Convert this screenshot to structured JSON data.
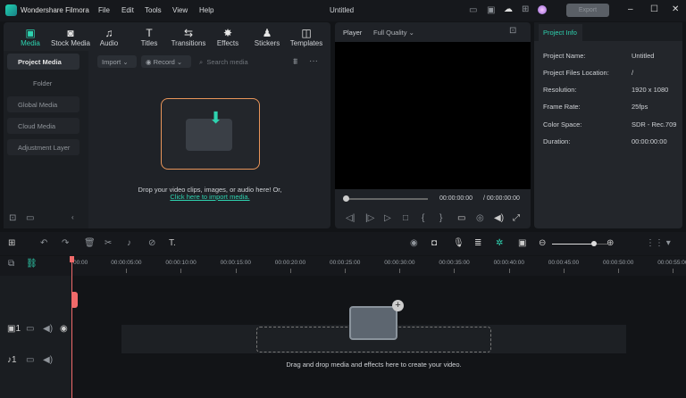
{
  "app": {
    "name": "Wondershare Filmora",
    "title": "Untitled",
    "export_label": "Export"
  },
  "menu": [
    "File",
    "Edit",
    "Tools",
    "View",
    "Help"
  ],
  "tabs": [
    {
      "label": "Media",
      "icon": "media-icon"
    },
    {
      "label": "Stock Media",
      "icon": "stock-icon"
    },
    {
      "label": "Audio",
      "icon": "music-icon"
    },
    {
      "label": "Titles",
      "icon": "text-icon"
    },
    {
      "label": "Transitions",
      "icon": "transition-icon"
    },
    {
      "label": "Effects",
      "icon": "sparkle-icon"
    },
    {
      "label": "Stickers",
      "icon": "sticker-icon"
    },
    {
      "label": "Templates",
      "icon": "template-icon"
    }
  ],
  "sidebar": {
    "items": [
      "Project Media",
      "Folder",
      "Global Media",
      "Cloud Media",
      "Adjustment Layer"
    ]
  },
  "media": {
    "import": "Import",
    "record": "Record",
    "search_placeholder": "Search media",
    "drop_text": "Drop your video clips, images, or audio here! Or,",
    "import_link": "Click here to import media."
  },
  "player": {
    "label": "Player",
    "quality": "Full Quality",
    "current_time": "00:00:00:00",
    "total_time": "/ 00:00:00:00"
  },
  "info": {
    "tab": "Project Info",
    "rows": [
      {
        "k": "Project Name:",
        "v": "Untitled"
      },
      {
        "k": "Project Files Location:",
        "v": "/"
      },
      {
        "k": "Resolution:",
        "v": "1920 x 1080"
      },
      {
        "k": "Frame Rate:",
        "v": "25fps"
      },
      {
        "k": "Color Space:",
        "v": "SDR - Rec.709"
      },
      {
        "k": "Duration:",
        "v": "00:00:00:00"
      }
    ]
  },
  "timeline": {
    "ticks": [
      "00:00",
      "00:00:05:00",
      "00:00:10:00",
      "00:00:15:00",
      "00:00:20:00",
      "00:00:25:00",
      "00:00:30:00",
      "00:00:35:00",
      "00:00:40:00",
      "00:00:45:00",
      "00:00:50:00",
      "00:00:55:00"
    ],
    "drop_text": "Drag and drop media and effects here to create your video.",
    "zoom_level": 0.75
  },
  "colors": {
    "accent": "#2ed3b0",
    "playhead": "#f06a6a"
  }
}
